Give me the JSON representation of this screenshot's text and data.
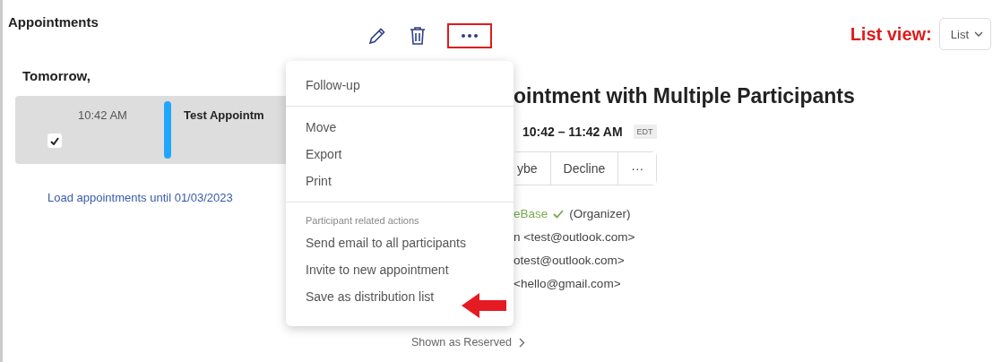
{
  "header": {
    "title": "Appointments",
    "annotation_label": "List view:",
    "view_select": {
      "value": "List"
    }
  },
  "list": {
    "day_heading": "Tomorrow,",
    "appointments": [
      {
        "time": "10:42 AM",
        "title": "Test Appointm",
        "checked": true,
        "selected": true,
        "color": "#1ea7fd"
      }
    ],
    "load_more": "Load appointments until 01/03/2023"
  },
  "detail": {
    "title": "ointment with Multiple Participants",
    "time": "10:42 – 11:42 AM",
    "timezone": "EDT",
    "responses": [
      "ybe",
      "Decline",
      "···"
    ],
    "participants": [
      {
        "name": "eBase",
        "organizer_note": "(Organizer)",
        "accepted": true
      },
      {
        "name": "n <test@outlook.com>",
        "accepted": false
      },
      {
        "name": "otest@outlook.com>",
        "accepted": false
      },
      {
        "name": "<hello@gmail.com>",
        "accepted": false
      }
    ],
    "show_as": "Shown as Reserved"
  },
  "menu": {
    "sections": [
      {
        "items": [
          "Follow-up"
        ]
      },
      {
        "items": [
          "Move",
          "Export",
          "Print"
        ]
      },
      {
        "heading": "Participant related actions",
        "items": [
          "Send email to all participants",
          "Invite to new appointment",
          "Save as distribution list"
        ]
      }
    ]
  }
}
